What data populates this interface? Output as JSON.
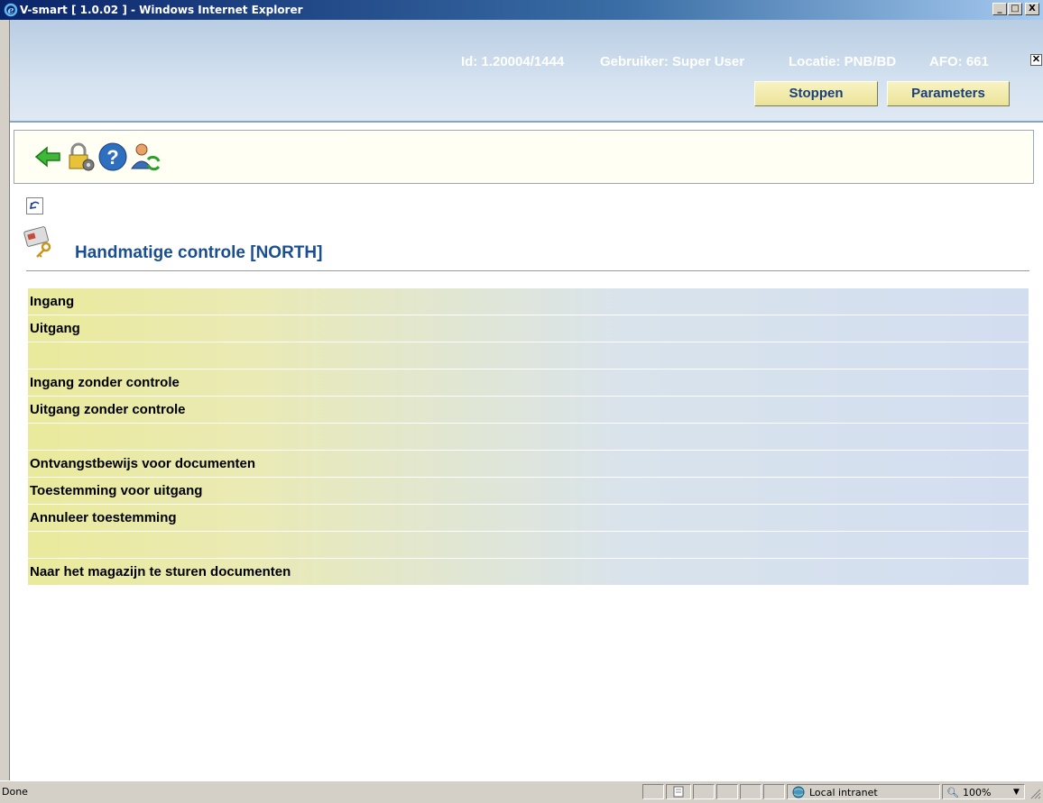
{
  "window": {
    "title": "V-smart [ 1.0.02 ] - Windows Internet Explorer",
    "minimize_label": "_",
    "maximize_label": "□",
    "close_label": "X"
  },
  "header": {
    "id_label": "Id: 1.20004/1444",
    "user_label": "Gebruiker: Super User",
    "location_label": "Locatie: PNB/BD",
    "afo_label": "AFO: 661",
    "close_label": "✕",
    "stop_button": "Stoppen",
    "parameters_button": "Parameters"
  },
  "toolbar": {
    "icons": [
      "back-arrow-icon",
      "lock-settings-icon",
      "help-icon",
      "user-switch-icon"
    ]
  },
  "page": {
    "title": "Handmatige controle [NORTH]"
  },
  "menu": {
    "items": [
      "Ingang",
      "Uitgang",
      "",
      "Ingang zonder controle",
      "Uitgang zonder controle",
      "",
      "Ontvangstbewijs voor documenten",
      "Toestemming voor uitgang",
      "Annuleer toestemming",
      "",
      "Naar het magazijn te sturen documenten"
    ]
  },
  "statusbar": {
    "status": "Done",
    "zone": "Local intranet",
    "zoom": "100%"
  },
  "colors": {
    "title_blue": "#1a4f8f",
    "button_yellow": "#ebe399",
    "header_blue": "#b9cde3"
  }
}
